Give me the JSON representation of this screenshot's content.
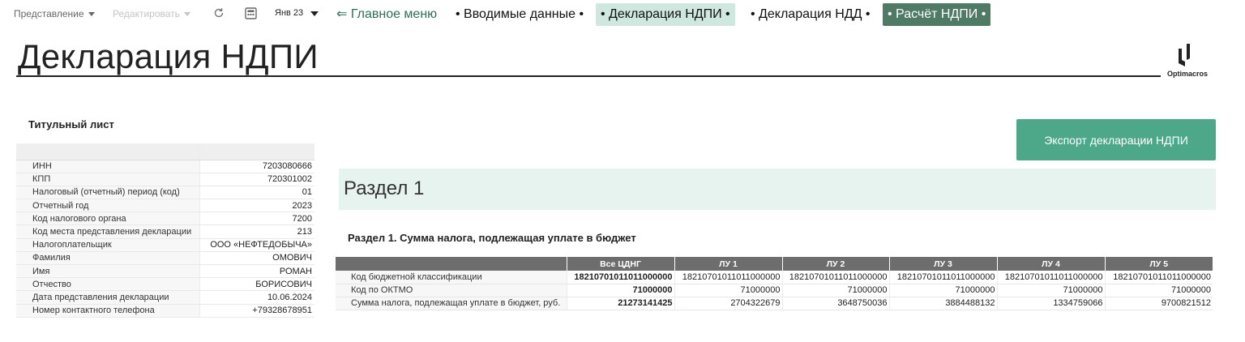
{
  "toolbar": {
    "view_label": "Представление",
    "edit_label": "Редактировать",
    "period_label": "Янв 23"
  },
  "nav": [
    {
      "label": "⇐ Главное меню"
    },
    {
      "label": "• Вводимые данные •"
    },
    {
      "label": "• Декларация НДПИ •"
    },
    {
      "label": "• Декларация НДД •"
    },
    {
      "label": "• Расчёт НДПИ •"
    }
  ],
  "page": {
    "title": "Декларация НДПИ",
    "logo_text": "Optimacros"
  },
  "title_sheet": {
    "heading": "Титульный лист",
    "rows": [
      {
        "label": "ИНН",
        "value": "7203080666"
      },
      {
        "label": "КПП",
        "value": "720301002"
      },
      {
        "label": "Налоговый (отчетный) период (код)",
        "value": "01"
      },
      {
        "label": "Отчетный год",
        "value": "2023"
      },
      {
        "label": "Код налогового органа",
        "value": "7200"
      },
      {
        "label": "Код места представления декларации",
        "value": "213"
      },
      {
        "label": "Налогоплательщик",
        "value": "ООО «НЕФТЕДОБЫЧА»"
      },
      {
        "label": "Фамилия",
        "value": "ОМОВИЧ"
      },
      {
        "label": "Имя",
        "value": "РОМАН"
      },
      {
        "label": "Отчество",
        "value": "БОРИСОВИЧ"
      },
      {
        "label": "Дата представления декларации",
        "value": "10.06.2024"
      },
      {
        "label": "Номер контактного телефона",
        "value": "+79328678951"
      }
    ]
  },
  "export_button": "Экспорт декларации НДПИ",
  "section": {
    "banner": "Раздел 1",
    "subtitle": "Раздел 1. Сумма налога, подлежащая уплате в бюджет",
    "columns": [
      "Все ЦДНГ",
      "ЛУ 1",
      "ЛУ 2",
      "ЛУ 3",
      "ЛУ 4",
      "ЛУ 5"
    ],
    "rows": [
      {
        "label": "Код бюджетной классификации",
        "values": [
          "18210701011011000000",
          "18210701011011000000",
          "18210701011011000000",
          "18210701011011000000",
          "18210701011011000000",
          "18210701011011000000"
        ]
      },
      {
        "label": "Код по ОКТМО",
        "values": [
          "71000000",
          "71000000",
          "71000000",
          "71000000",
          "71000000",
          "71000000"
        ]
      },
      {
        "label": "Сумма налога, подлежащая уплате в бюджет, руб.",
        "values": [
          "21273141425",
          "2704322679",
          "3648750036",
          "3884488132",
          "1334759066",
          "9700821512"
        ]
      }
    ]
  }
}
